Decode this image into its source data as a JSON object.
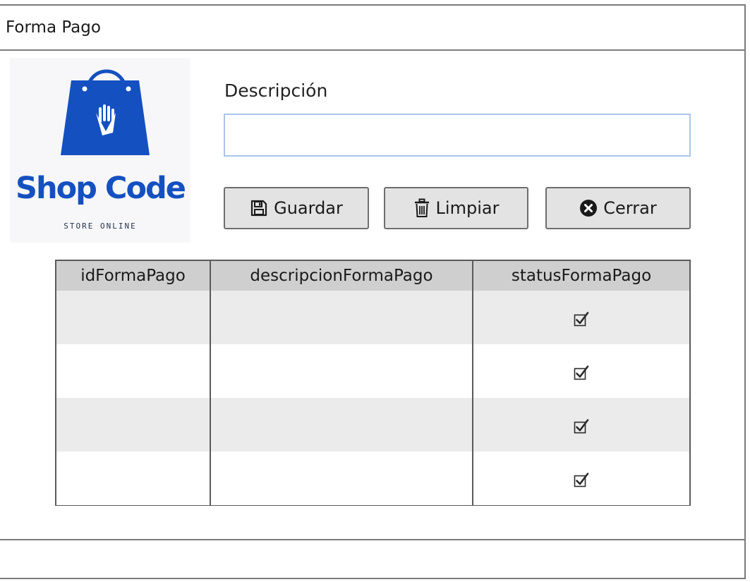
{
  "window": {
    "title": "Forma Pago"
  },
  "logo": {
    "title": "Shop Code",
    "subtitle": "STORE ONLINE",
    "brand_color": "#1450c0"
  },
  "form": {
    "description_label": "Descripción",
    "description_value": "",
    "description_placeholder": ""
  },
  "buttons": {
    "save_label": "Guardar",
    "clear_label": "Limpiar",
    "close_label": "Cerrar",
    "save_icon": "floppy-disk-icon",
    "clear_icon": "trash-icon",
    "close_icon": "close-circle-icon"
  },
  "table": {
    "columns": [
      "idFormaPago",
      "descripcionFormaPago",
      "statusFormaPago"
    ],
    "rows": [
      {
        "id": "",
        "descripcion": "",
        "status": true
      },
      {
        "id": "",
        "descripcion": "",
        "status": true
      },
      {
        "id": "",
        "descripcion": "",
        "status": true
      },
      {
        "id": "",
        "descripcion": "",
        "status": true
      }
    ],
    "header_bg": "#cfcfcf",
    "stripe_bg": "#ebebeb"
  }
}
